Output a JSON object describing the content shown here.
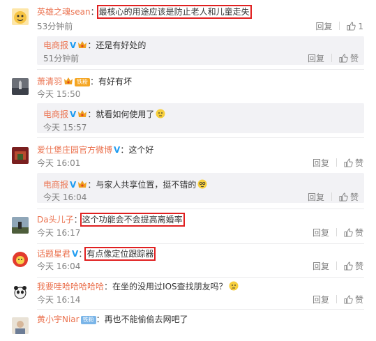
{
  "ui": {
    "reply_label": "回复",
    "like_label": "赞",
    "verified_mark": "V",
    "colon": "："
  },
  "comments": [
    {
      "name": "英雄之魂sean",
      "text": "最核心的用途应该是防止老人和儿童走失",
      "time": "53分钟前",
      "likes": "1",
      "reply": {
        "name": "电商报",
        "verified": true,
        "text": "还是有好处的",
        "time": "51分钟前"
      }
    },
    {
      "name": "萧清羽",
      "tag": "铁粉",
      "text": "有好有坏",
      "time": "今天 15:50",
      "reply": {
        "name": "电商报",
        "verified": true,
        "text": "就看如何使用了",
        "time": "今天 15:57"
      }
    },
    {
      "name": "爱仕堡庄园官方微博",
      "verified": true,
      "text": "这个好",
      "time": "今天 16:01",
      "reply": {
        "name": "电商报",
        "verified": true,
        "text": "与家人共享位置，挺不错的",
        "time": "今天 16:04"
      }
    },
    {
      "name": "Da头儿子",
      "text": "这个功能会不会提高离婚率",
      "time": "今天 16:17"
    },
    {
      "name": "话题星君",
      "verified": true,
      "text": "有点像定位跟踪器",
      "time": "今天 16:04"
    },
    {
      "name": "我要哇哈哈哈哈哈",
      "text": "在坐的没用过IOS查找朋友吗？",
      "time": "今天 16:14"
    },
    {
      "name": "黄小宇Niar",
      "tag": "铁粉",
      "text": "再也不能偷偷去网吧了",
      "time": ""
    }
  ],
  "colors": {
    "name": "#eb7350",
    "verified": "#1d9bf0",
    "highlight": "#e02020",
    "muted": "#808080",
    "reply_bg": "#f2f2f5"
  },
  "icons": [
    "like-icon",
    "vip-crown-icon",
    "verified-icon",
    "emoji-smile-icon",
    "emoji-think-icon"
  ]
}
